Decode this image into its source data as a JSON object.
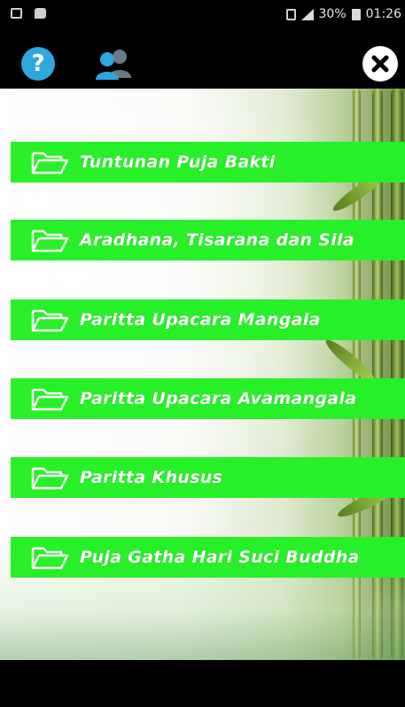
{
  "status_bar": {
    "battery_percent": "30%",
    "time": "01:26"
  },
  "toolbar": {
    "help_icon": "help-icon",
    "users_icon": "users-icon",
    "close_icon": "close-icon"
  },
  "menu": {
    "items": [
      {
        "label": "Tuntunan Puja Bakti",
        "icon": "folder-icon"
      },
      {
        "label": "Aradhana, Tisarana dan Sila",
        "icon": "folder-icon"
      },
      {
        "label": "Paritta Upacara Mangala",
        "icon": "folder-icon"
      },
      {
        "label": "Paritta Upacara Avamangala",
        "icon": "folder-icon"
      },
      {
        "label": "Paritta Khusus",
        "icon": "folder-icon"
      },
      {
        "label": "Puja Gatha Hari Suci Buddha",
        "icon": "folder-icon"
      }
    ]
  },
  "colors": {
    "menu_bg": "#28f028",
    "help_blue": "#2ea7e0",
    "bar_black": "#000000"
  }
}
